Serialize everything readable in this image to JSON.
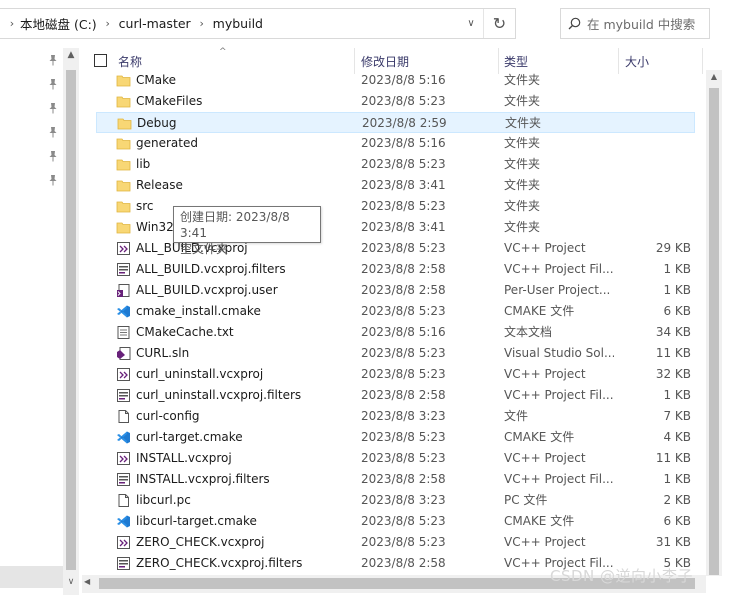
{
  "breadcrumb": {
    "items": [
      "本地磁盘 (C:)",
      "curl-master",
      "mybuild"
    ]
  },
  "search": {
    "placeholder": "在 mybuild 中搜索"
  },
  "columns": {
    "name": "名称",
    "date": "修改日期",
    "type": "类型",
    "size": "大小"
  },
  "files": [
    {
      "name": "CMake",
      "date": "2023/8/8 5:16",
      "type": "文件夹",
      "size": "",
      "icon": "folder-icon"
    },
    {
      "name": "CMakeFiles",
      "date": "2023/8/8 5:23",
      "type": "文件夹",
      "size": "",
      "icon": "folder-icon"
    },
    {
      "name": "Debug",
      "date": "2023/8/8 2:59",
      "type": "文件夹",
      "size": "",
      "icon": "folder-icon"
    },
    {
      "name": "generated",
      "date": "2023/8/8 5:16",
      "type": "文件夹",
      "size": "",
      "icon": "folder-icon"
    },
    {
      "name": "lib",
      "date": "2023/8/8 5:23",
      "type": "文件夹",
      "size": "",
      "icon": "folder-icon"
    },
    {
      "name": "Release",
      "date": "2023/8/8 3:41",
      "type": "文件夹",
      "size": "",
      "icon": "folder-icon"
    },
    {
      "name": "src",
      "date": "2023/8/8 5:23",
      "type": "文件夹",
      "size": "",
      "icon": "folder-icon"
    },
    {
      "name": "Win32",
      "date": "2023/8/8 3:41",
      "type": "文件夹",
      "size": "",
      "icon": "folder-icon"
    },
    {
      "name": "ALL_BUILD.vcxproj",
      "date": "2023/8/8 5:23",
      "type": "VC++ Project",
      "size": "29 KB",
      "icon": "vcxproj-icon"
    },
    {
      "name": "ALL_BUILD.vcxproj.filters",
      "date": "2023/8/8 2:58",
      "type": "VC++ Project Fil...",
      "size": "1 KB",
      "icon": "filters-icon"
    },
    {
      "name": "ALL_BUILD.vcxproj.user",
      "date": "2023/8/8 2:58",
      "type": "Per-User Project...",
      "size": "1 KB",
      "icon": "user-file-icon"
    },
    {
      "name": "cmake_install.cmake",
      "date": "2023/8/8 5:23",
      "type": "CMAKE 文件",
      "size": "6 KB",
      "icon": "vscode-icon"
    },
    {
      "name": "CMakeCache.txt",
      "date": "2023/8/8 5:16",
      "type": "文本文档",
      "size": "34 KB",
      "icon": "text-file-icon"
    },
    {
      "name": "CURL.sln",
      "date": "2023/8/8 5:23",
      "type": "Visual Studio Sol...",
      "size": "11 KB",
      "icon": "sln-icon"
    },
    {
      "name": "curl_uninstall.vcxproj",
      "date": "2023/8/8 5:23",
      "type": "VC++ Project",
      "size": "32 KB",
      "icon": "vcxproj-icon"
    },
    {
      "name": "curl_uninstall.vcxproj.filters",
      "date": "2023/8/8 2:58",
      "type": "VC++ Project Fil...",
      "size": "1 KB",
      "icon": "filters-icon"
    },
    {
      "name": "curl-config",
      "date": "2023/8/8 3:23",
      "type": "文件",
      "size": "7 KB",
      "icon": "blank-file-icon"
    },
    {
      "name": "curl-target.cmake",
      "date": "2023/8/8 5:23",
      "type": "CMAKE 文件",
      "size": "4 KB",
      "icon": "vscode-icon"
    },
    {
      "name": "INSTALL.vcxproj",
      "date": "2023/8/8 5:23",
      "type": "VC++ Project",
      "size": "11 KB",
      "icon": "vcxproj-icon"
    },
    {
      "name": "INSTALL.vcxproj.filters",
      "date": "2023/8/8 2:58",
      "type": "VC++ Project Fil...",
      "size": "1 KB",
      "icon": "filters-icon"
    },
    {
      "name": "libcurl.pc",
      "date": "2023/8/8 3:23",
      "type": "PC 文件",
      "size": "2 KB",
      "icon": "blank-file-icon"
    },
    {
      "name": "libcurl-target.cmake",
      "date": "2023/8/8 5:23",
      "type": "CMAKE 文件",
      "size": "6 KB",
      "icon": "vscode-icon"
    },
    {
      "name": "ZERO_CHECK.vcxproj",
      "date": "2023/8/8 5:23",
      "type": "VC++ Project",
      "size": "31 KB",
      "icon": "vcxproj-icon"
    },
    {
      "name": "ZERO_CHECK.vcxproj.filters",
      "date": "2023/8/8 2:58",
      "type": "VC++ Project Fil...",
      "size": "5 KB",
      "icon": "filters-icon"
    }
  ],
  "selected_index": 2,
  "tooltip": {
    "line1": "创建日期: 2023/8/8 3:41",
    "line2": "空文件夹"
  },
  "watermark": "CSDN @逆向小李子",
  "colors": {
    "folder": "#f8d775",
    "selection": "#e5f3ff",
    "vscode": "#1f7ad1",
    "vs_purple": "#68217a"
  }
}
